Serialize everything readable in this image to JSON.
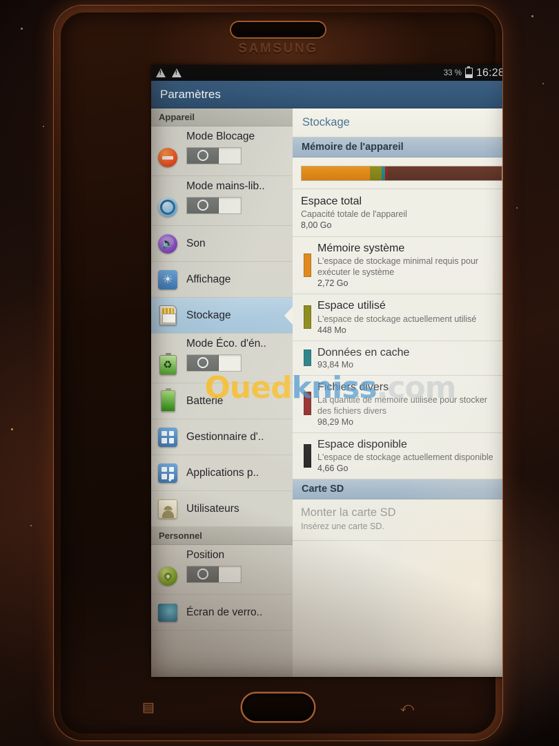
{
  "device": {
    "brand": "SAMSUNG",
    "keys": {
      "menu": "▤",
      "back": "⤺"
    }
  },
  "statusbar": {
    "battery_percent": "33 %",
    "clock": "16:28",
    "warning_icon": "warning-triangle-icon"
  },
  "actionbar": {
    "title": "Paramètres"
  },
  "sidebar": {
    "sections": [
      {
        "header": "Appareil",
        "items": [
          {
            "label": "Mode Blocage",
            "icon": "block-mode-icon",
            "toggle": true,
            "selected": false
          },
          {
            "label": "Mode mains-lib..",
            "icon": "handsfree-icon",
            "toggle": true,
            "selected": false
          },
          {
            "label": "Son",
            "icon": "sound-icon",
            "toggle": false,
            "selected": false
          },
          {
            "label": "Affichage",
            "icon": "display-icon",
            "toggle": false,
            "selected": false
          },
          {
            "label": "Stockage",
            "icon": "sd-card-icon",
            "toggle": false,
            "selected": true
          },
          {
            "label": "Mode Éco. d'én..",
            "icon": "power-saving-icon",
            "toggle": true,
            "selected": false
          },
          {
            "label": "Batterie",
            "icon": "battery-icon",
            "toggle": false,
            "selected": false
          },
          {
            "label": "Gestionnaire d'..",
            "icon": "app-manager-icon",
            "toggle": false,
            "selected": false
          },
          {
            "label": "Applications p..",
            "icon": "default-apps-icon",
            "toggle": false,
            "selected": false
          },
          {
            "label": "Utilisateurs",
            "icon": "users-icon",
            "toggle": false,
            "selected": false
          }
        ]
      },
      {
        "header": "Personnel",
        "items": [
          {
            "label": "Position",
            "icon": "location-icon",
            "toggle": true,
            "selected": false
          },
          {
            "label": "Écran de verro..",
            "icon": "lockscreen-icon",
            "toggle": false,
            "selected": false
          }
        ]
      }
    ]
  },
  "storage": {
    "title": "Stockage",
    "device_memory_header": "Mémoire de l'appareil",
    "total": {
      "title": "Espace total",
      "subtitle": "Capacité totale de l'appareil",
      "value": "8,00 Go"
    },
    "entries": [
      {
        "title": "Mémoire système",
        "subtitle": "L'espace de stockage minimal requis pour exécuter le système",
        "value": "2,72 Go",
        "color": "#e08a1e"
      },
      {
        "title": "Espace utilisé",
        "subtitle": "L'espace de stockage actuellement utilisé",
        "value": "448 Mo",
        "color": "#8d8a1c"
      },
      {
        "title": "Données en cache",
        "subtitle": "",
        "value": "93,84 Mo",
        "color": "#1d7b80"
      },
      {
        "title": "Fichiers divers",
        "subtitle": "La quantité de mémoire utilisée pour stocker des fichiers divers",
        "value": "98,29 Mo",
        "color": "#8e2220"
      },
      {
        "title": "Espace disponible",
        "subtitle": "L'espace de stockage actuellement disponible",
        "value": "4,66 Go",
        "color": "#262626"
      }
    ],
    "sd_header": "Carte SD",
    "sd_mount": {
      "title": "Monter la carte SD",
      "subtitle": "Insérez une carte SD."
    }
  },
  "chart_data": {
    "type": "bar",
    "title": "Mémoire de l'appareil",
    "categories": [
      "Mémoire système",
      "Espace utilisé",
      "Données en cache",
      "Fichiers divers",
      "Espace disponible"
    ],
    "values": [
      2.72,
      0.4375,
      0.09164,
      0.09599,
      4.66
    ],
    "unit": "Go",
    "total": 8.0,
    "colors": [
      "#e08a1e",
      "#8d8a1c",
      "#1d7b80",
      "#8e2220",
      "#5b3327"
    ],
    "widths_percent": [
      34.0,
      6.0,
      1.6,
      1.6,
      56.8
    ],
    "ylabel": "",
    "xlabel": "",
    "grid": false,
    "legend": "inline-swatches"
  },
  "watermark": {
    "part1": "Oued",
    "part2": "kniss",
    "part3": ".com"
  }
}
